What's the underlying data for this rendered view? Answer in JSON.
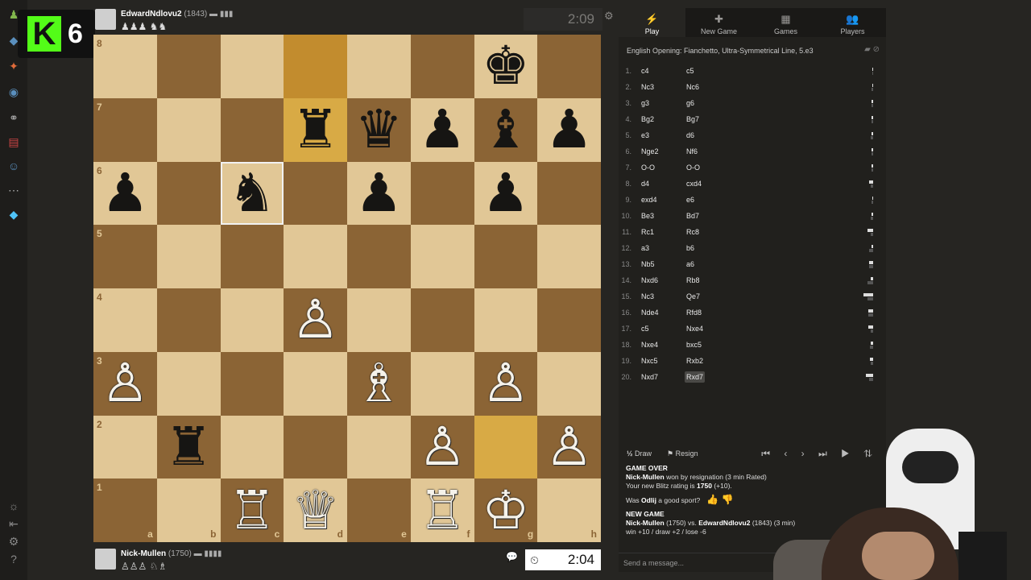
{
  "stream": {
    "badge_letter": "K",
    "badge_count": "6"
  },
  "top_player": {
    "name": "EdwardNdlovu2",
    "rating": "(1843)",
    "flags": "▬ ▮▮▮",
    "captured": "♟♟♟ ♞♞",
    "clock": "2:09"
  },
  "bottom_player": {
    "name": "Nick-Mullen",
    "rating": "(1750)",
    "flags": "▬ ▮▮▮▮",
    "captured": "♙♙♙ ♘♗",
    "clock": "2:04"
  },
  "board": {
    "rank_labels": [
      "8",
      "7",
      "6",
      "5",
      "4",
      "3",
      "2",
      "1"
    ],
    "file_labels": [
      "a",
      "b",
      "c",
      "d",
      "e",
      "f",
      "g",
      "h"
    ],
    "pieces": [
      {
        "sq": "g8",
        "glyph": "♚",
        "color": "black"
      },
      {
        "sq": "d7",
        "glyph": "♜",
        "color": "black"
      },
      {
        "sq": "e7",
        "glyph": "♛",
        "color": "black"
      },
      {
        "sq": "f7",
        "glyph": "♟",
        "color": "black"
      },
      {
        "sq": "g7",
        "glyph": "♝",
        "color": "black"
      },
      {
        "sq": "h7",
        "glyph": "♟",
        "color": "black"
      },
      {
        "sq": "a6",
        "glyph": "♟",
        "color": "black"
      },
      {
        "sq": "c6",
        "glyph": "♞",
        "color": "black"
      },
      {
        "sq": "e6",
        "glyph": "♟",
        "color": "black"
      },
      {
        "sq": "g6",
        "glyph": "♟",
        "color": "black"
      },
      {
        "sq": "d4",
        "glyph": "♙",
        "color": "white"
      },
      {
        "sq": "a3",
        "glyph": "♙",
        "color": "white"
      },
      {
        "sq": "e3",
        "glyph": "♗",
        "color": "white"
      },
      {
        "sq": "g3",
        "glyph": "♙",
        "color": "white"
      },
      {
        "sq": "b2",
        "glyph": "♜",
        "color": "black"
      },
      {
        "sq": "f2",
        "glyph": "♙",
        "color": "white"
      },
      {
        "sq": "h2",
        "glyph": "♙",
        "color": "white"
      },
      {
        "sq": "c1",
        "glyph": "♖",
        "color": "white"
      },
      {
        "sq": "d1",
        "glyph": "♕",
        "color": "white"
      },
      {
        "sq": "f1",
        "glyph": "♖",
        "color": "white"
      },
      {
        "sq": "g1",
        "glyph": "♔",
        "color": "white"
      }
    ],
    "highlighted": [
      "d8",
      "d7",
      "g2"
    ],
    "selected": "c6"
  },
  "panel": {
    "tabs": [
      {
        "label": "Play",
        "icon": "⚡",
        "active": true
      },
      {
        "label": "New Game",
        "icon": "✚",
        "active": false
      },
      {
        "label": "Games",
        "icon": "▦",
        "active": false
      },
      {
        "label": "Players",
        "icon": "👥",
        "active": false
      }
    ],
    "opening": "English Opening: Fianchetto, Ultra-Symmetrical Line, 5.e3",
    "moves": [
      {
        "n": "1.",
        "w": "c4",
        "b": "c5",
        "ew": 0.1,
        "eb": 0.1
      },
      {
        "n": "2.",
        "w": "Nc3",
        "b": "Nc6",
        "ew": 0.4,
        "eb": 0.7
      },
      {
        "n": "3.",
        "w": "g3",
        "b": "g6",
        "ew": 0.5,
        "eb": 0.8
      },
      {
        "n": "4.",
        "w": "Bg2",
        "b": "Bg7",
        "ew": 0.5,
        "eb": 0.9
      },
      {
        "n": "5.",
        "w": "e3",
        "b": "d6",
        "ew": 0.7,
        "eb": 2.1
      },
      {
        "n": "6.",
        "w": "Nge2",
        "b": "Nf6",
        "ew": 0.5,
        "eb": 1.1
      },
      {
        "n": "7.",
        "w": "O-O",
        "b": "O-O",
        "ew": 1.2,
        "eb": 0.8
      },
      {
        "n": "8.",
        "w": "d4",
        "b": "cxd4",
        "ew": 3.8,
        "eb": 1.4
      },
      {
        "n": "9.",
        "w": "exd4",
        "b": "e6",
        "ew": 0.1,
        "eb": 1.1
      },
      {
        "n": "10.",
        "w": "Be3",
        "b": "Bd7",
        "ew": 0.7,
        "eb": 2.0
      },
      {
        "n": "11.",
        "w": "Rc1",
        "b": "Rc8",
        "ew": 5.2,
        "eb": 1.4
      },
      {
        "n": "12.",
        "w": "a3",
        "b": "b6",
        "ew": 0.7,
        "eb": 3.3
      },
      {
        "n": "13.",
        "w": "Nb5",
        "b": "a6",
        "ew": 3.8,
        "eb": 3.7
      },
      {
        "n": "14.",
        "w": "Nxd6",
        "b": "Rb8",
        "ew": 1.7,
        "eb": 5.5
      },
      {
        "n": "15.",
        "w": "Nc3",
        "b": "Qe7",
        "ew": 10.8,
        "eb": 5.3
      },
      {
        "n": "16.",
        "w": "Nde4",
        "b": "Rfd8",
        "ew": 4.8,
        "eb": 4.6
      },
      {
        "n": "17.",
        "w": "c5",
        "b": "Nxe4",
        "ew": 5.0,
        "eb": 1.4
      },
      {
        "n": "18.",
        "w": "Nxe4",
        "b": "bxc5",
        "ew": 2.1,
        "eb": 2.7
      },
      {
        "n": "19.",
        "w": "Nxc5",
        "b": "Rxb2",
        "ew": 2.8,
        "eb": 1.4
      },
      {
        "n": "20.",
        "w": "Nxd7",
        "b": "Rxd7",
        "ew": 7.4,
        "eb": 3.7
      }
    ],
    "draw_label": "Draw",
    "draw_icon": "½",
    "resign_label": "Resign",
    "nav_icons": "⏮ ‹ › ⏭ ▶ ⇅",
    "log": {
      "game_over": "GAME OVER",
      "winner": "Nick-Mullen",
      "won_by": " won by resignation (3 min Rated)",
      "rating_line_prefix": "Your new Blitz rating is ",
      "rating_value": "1750",
      "rating_suffix": " (+10).",
      "sport_prefix": "Was ",
      "sport_name": "Odlij",
      "sport_suffix": " a good sport?",
      "new_game": "NEW GAME",
      "match_a": "Nick-Mullen",
      "match_a_rating": " (1750) vs. ",
      "match_b": "EdwardNdlovu2",
      "match_b_rating": " (1843) (3 min)",
      "stakes": "win +10 / draw +2 / lose -6"
    },
    "send_placeholder": "Send a message..."
  }
}
